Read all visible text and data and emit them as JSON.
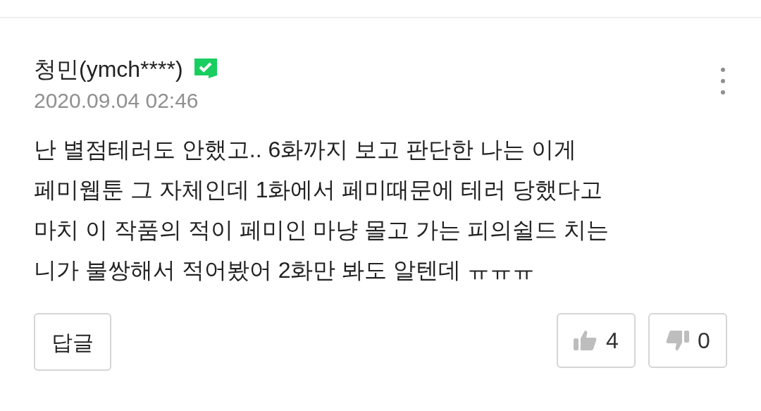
{
  "comment": {
    "author": "청민(ymch****)",
    "verified": true,
    "date": "2020.09.04 02:46",
    "body_lines": [
      "난 별점테러도 안했고.. 6화까지 보고 판단한 나는 이게",
      "페미웹툰 그 자체인데 1화에서 페미때문에 테러 당했다고",
      "마치 이 작품의 적이 페미인 마냥 몰고 가는 피의쉴드 치는",
      "니가 불쌍해서 적어봤어 2화만 봐도 알텐데 ㅠㅠㅠ"
    ],
    "reply_button": "답글",
    "likes": "4",
    "dislikes": "0"
  }
}
